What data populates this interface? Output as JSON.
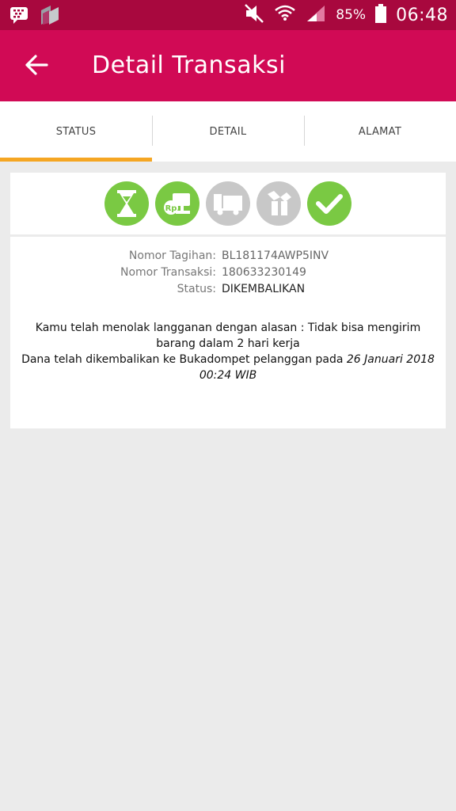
{
  "status_bar": {
    "battery": "85%",
    "time": "06:48"
  },
  "app_bar": {
    "title": "Detail Transaksi"
  },
  "tabs": [
    {
      "label": "STATUS",
      "active": true
    },
    {
      "label": "DETAIL",
      "active": false
    },
    {
      "label": "ALAMAT",
      "active": false
    }
  ],
  "progress": {
    "steps": [
      {
        "icon": "hourglass-icon",
        "state": "done"
      },
      {
        "icon": "payment-icon",
        "state": "done"
      },
      {
        "icon": "truck-icon",
        "state": "pending"
      },
      {
        "icon": "package-icon",
        "state": "pending"
      },
      {
        "icon": "checkmark-icon",
        "state": "done"
      }
    ],
    "colors": {
      "done": "#7ac943",
      "pending": "#c8c8c8"
    }
  },
  "transaction": {
    "invoice_label": "Nomor Tagihan:",
    "invoice_value": "BL181174AWP5INV",
    "transaction_label": "Nomor Transaksi:",
    "transaction_value": "180633230149",
    "status_label": "Status:",
    "status_value": "DIKEMBALIKAN"
  },
  "messages": {
    "rejection": "Kamu telah menolak langganan dengan alasan : Tidak bisa mengirim barang dalam 2 hari kerja",
    "refund_prefix": "Dana telah dikembalikan ke Bukadompet pelanggan pada ",
    "refund_date": "26 Januari 2018 00:24 WIB"
  },
  "colors": {
    "statusbar": "#a8083e",
    "appbar": "#d10a55",
    "tab_indicator": "#f5a623",
    "background": "#ebebeb"
  }
}
